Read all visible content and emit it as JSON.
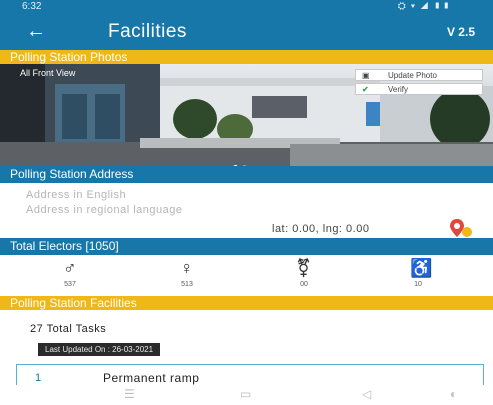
{
  "status_bar": {
    "time": "6:32",
    "icons": "⛭ ▾ ◢ ▮▮"
  },
  "app_bar": {
    "back_glyph": "←",
    "title": "Facilities",
    "version": "V 2.5"
  },
  "photos": {
    "header": "Polling Station Photos",
    "label": "All Front View",
    "update_button": "Update Photo",
    "verify_button": "Verify",
    "slide_count": 2,
    "active_slide": 1
  },
  "address": {
    "header": "Polling Station Address",
    "english": "Address in English",
    "regional": "Address in regional language",
    "coordinates": "lat: 0.00, lng: 0.00"
  },
  "electors": {
    "header": "Total Electors [1050]",
    "items": [
      {
        "icon": "male-voter-icon",
        "count": "537"
      },
      {
        "icon": "female-voter-icon",
        "count": "513"
      },
      {
        "icon": "third-gender-icon",
        "count": "00"
      },
      {
        "icon": "pwd-wheelchair-icon",
        "count": "10"
      }
    ]
  },
  "facilities": {
    "header": "Polling Station Facilities",
    "total_tasks": "27 Total Tasks",
    "last_updated": "Last Updated On : 26-03-2021",
    "first_task": {
      "number": "1",
      "label": "Permanent ramp"
    }
  },
  "colors": {
    "primary": "#1677a8",
    "accent": "#f0b816"
  }
}
